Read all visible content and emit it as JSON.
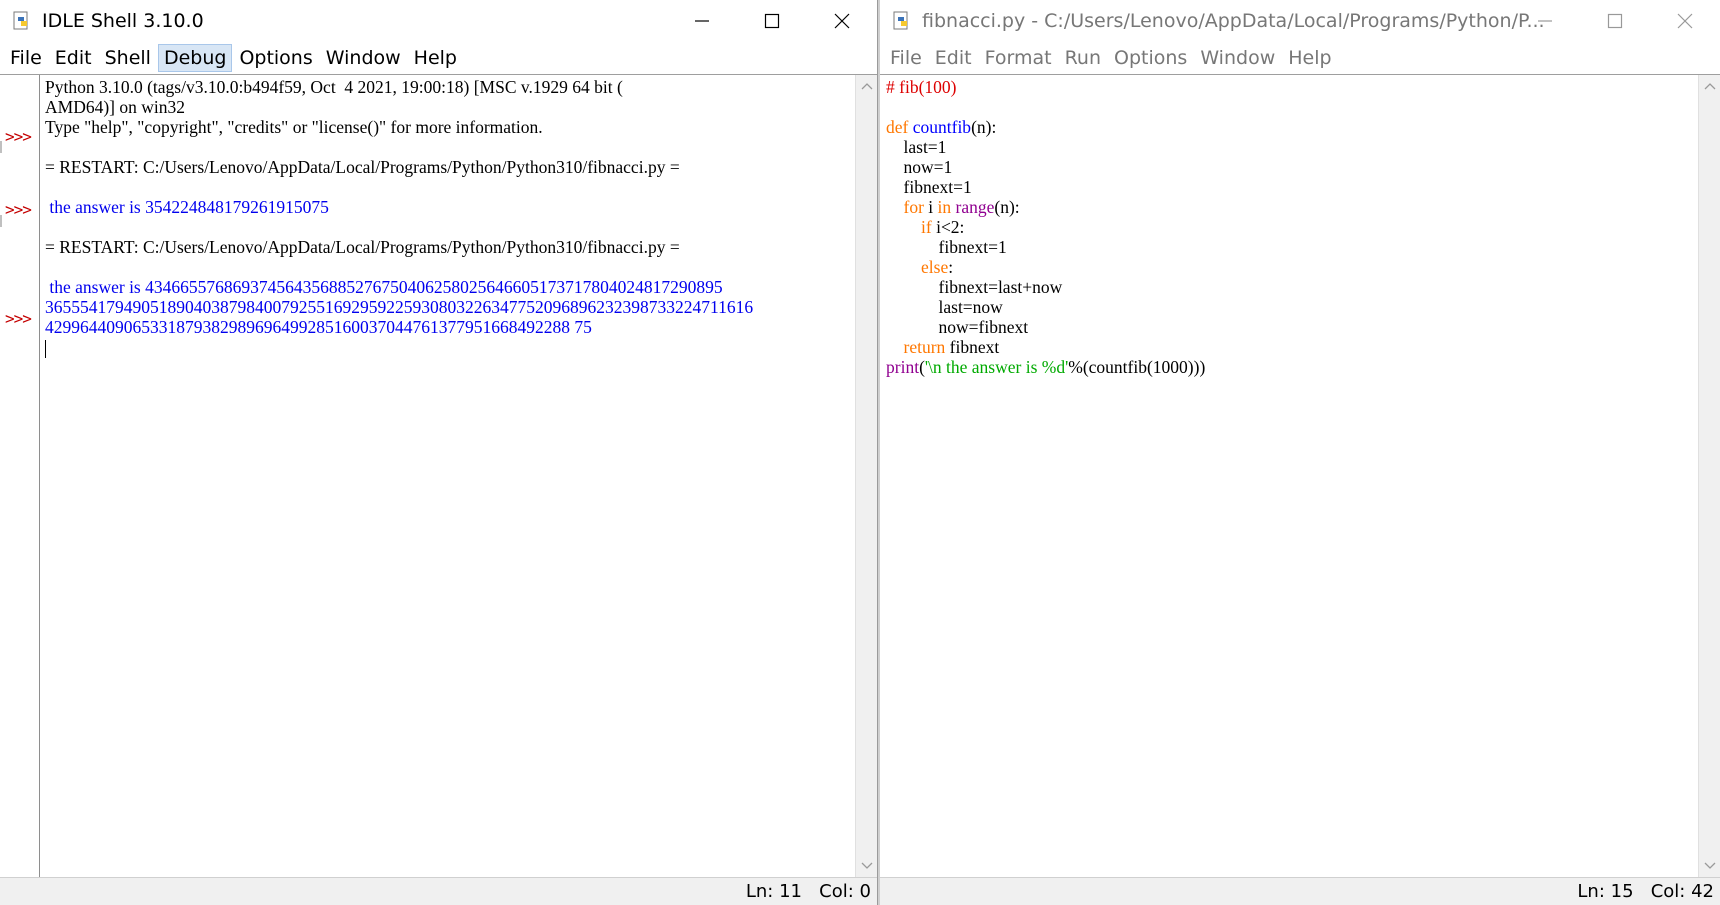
{
  "shell": {
    "title": "IDLE Shell 3.10.0",
    "menu": [
      "File",
      "Edit",
      "Shell",
      "Debug",
      "Options",
      "Window",
      "Help"
    ],
    "active_menu": "Debug",
    "prompt": ">>>",
    "lines": [
      "Python 3.10.0 (tags/v3.10.0:b494f59, Oct  4 2021, 19:00:18) [MSC v.1929 64 bit (",
      "AMD64)] on win32",
      "Type \"help\", \"copyright\", \"credits\" or \"license()\" for more information.",
      "",
      "= RESTART: C:/Users/Lenovo/AppData/Local/Programs/Python/Python310/fibnacci.py =",
      "",
      " the answer is 354224848179261915075",
      "",
      "= RESTART: C:/Users/Lenovo/AppData/Local/Programs/Python/Python310/fibnacci.py =",
      "",
      " the answer is 434665576869374564356885276750406258025646605173717804024817290895",
      "365554179490518904038798400792551692959225930803226347752096896232398733224711616",
      "429964409065331879382989696499285160037044761377951668492288 75"
    ],
    "status": {
      "line": "Ln: 11",
      "col": "Col: 0"
    }
  },
  "editor": {
    "title": "fibnacci.py - C:/Users/Lenovo/AppData/Local/Programs/Python/P...",
    "menu": [
      "File",
      "Edit",
      "Format",
      "Run",
      "Options",
      "Window",
      "Help"
    ],
    "code": {
      "l1_comment": "# fib(100)",
      "kw_def": "def",
      "fn_name": "countfib",
      "params": "(n):",
      "l4": "    last=1",
      "l5": "    now=1",
      "l6": "    fibnext=1",
      "kw_for": "for",
      "var_i": " i ",
      "kw_in": "in",
      "builtin_range": "range",
      "range_args": "(n):",
      "kw_if": "if",
      "if_cond": " i<2:",
      "l9": "            fibnext=1",
      "kw_else": "else",
      "colon": ":",
      "l11": "            fibnext=last+now",
      "l12": "            last=now",
      "l13": "            now=fibnext",
      "kw_return": "return",
      "return_val": " fibnext",
      "builtin_print": "print",
      "paren_open": "(",
      "string_lit": "'\\n the answer is %d'",
      "print_tail": "%(countfib(1000)))"
    },
    "status": {
      "line": "Ln: 15",
      "col": "Col: 42"
    }
  },
  "colors": {
    "prompt": "#c40000",
    "output": "#0000ee",
    "keyword": "#ff7700",
    "definition": "#0000ff",
    "builtin": "#900090",
    "string": "#00aa00",
    "comment": "#dd0000"
  }
}
